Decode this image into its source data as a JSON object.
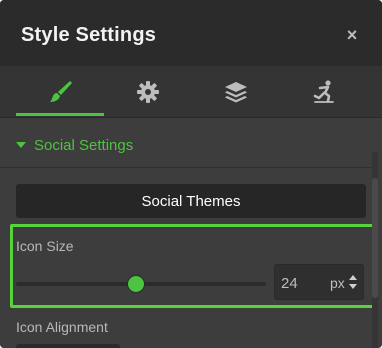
{
  "window": {
    "title": "Style Settings",
    "close_label": "×"
  },
  "tabs": [
    {
      "icon": "paintbrush-icon",
      "active": true
    },
    {
      "icon": "gear-icon",
      "active": false
    },
    {
      "icon": "layers-icon",
      "active": false
    },
    {
      "icon": "skater-icon",
      "active": false
    }
  ],
  "section": {
    "label": "Social Settings",
    "expanded": true
  },
  "themes_button": {
    "label": "Social Themes"
  },
  "icon_size": {
    "label": "Icon Size",
    "value": "24",
    "unit": "px",
    "slider_fraction": 0.48
  },
  "icon_alignment": {
    "label": "Icon Alignment"
  },
  "colors": {
    "accent": "#4cc43f",
    "highlight_border": "#57d43a",
    "panel": "#3d3d3d",
    "header": "#2b2b2b"
  }
}
